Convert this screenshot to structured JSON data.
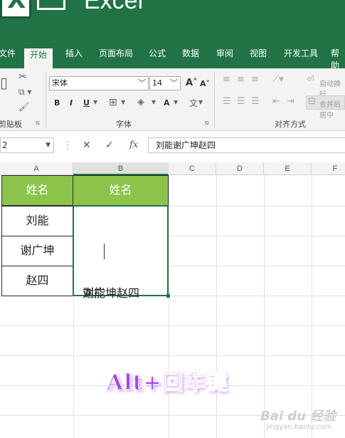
{
  "app": {
    "title": "Excel"
  },
  "tabs": [
    "文件",
    "开始",
    "插入",
    "页面布局",
    "公式",
    "数据",
    "审阅",
    "视图",
    "开发工具",
    "帮助"
  ],
  "ribbon": {
    "groups": {
      "clipboard": "剪贴板",
      "font": "字体",
      "alignment": "对齐方式"
    },
    "font_name": "宋体",
    "font_size": "14",
    "wrap_text": "自动换行",
    "merge_center": "合并后居中",
    "bold": "B",
    "italic": "I",
    "underline": "U",
    "grow_font": "A",
    "shrink_font": "A",
    "font_color": "A",
    "phonetic": "文"
  },
  "formula_bar": {
    "name_box": "2",
    "cancel": "✕",
    "enter": "✓",
    "fx": "fx",
    "value": "刘能谢广坤赵四"
  },
  "columns": [
    "A",
    "B",
    "C",
    "D",
    "E",
    "F"
  ],
  "table": {
    "header_a": "姓名",
    "header_b": "姓名",
    "names": [
      "刘能",
      "谢广坤",
      "赵四"
    ],
    "merged_value_before": "刘能",
    "merged_value_after": "谢广坤赵四"
  },
  "overlay": {
    "hint": "Alt+回车键"
  },
  "watermark": {
    "brand": "Bai du 经验",
    "sub": "jingyan.baidu.com"
  },
  "colors": {
    "brand": "#217346",
    "header_fill": "#8cc44a",
    "overlay": "#a24bdc"
  }
}
